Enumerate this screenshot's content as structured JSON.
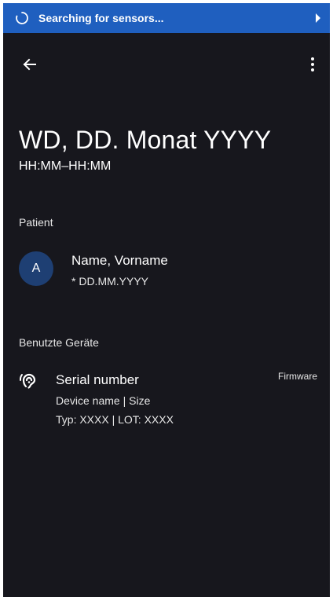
{
  "status_bar": {
    "text": "Searching for sensors...",
    "background": "#1f5fbf"
  },
  "toolbar": {
    "back_icon": "arrow-left-icon",
    "menu_icon": "more-vertical-icon"
  },
  "header": {
    "title": "WD, DD. Monat YYYY",
    "subtitle": "HH:MM–HH:MM"
  },
  "patient_section": {
    "label": "Patient",
    "avatar_initial": "A",
    "avatar_color": "#1e3f73",
    "name": "Name, Vorname",
    "dob": "* DD.MM.YYYY"
  },
  "devices_section": {
    "label": "Benutzte Geräte",
    "device": {
      "icon": "hearing-aid-icon",
      "serial": "Serial number",
      "firmware": "Firmware",
      "name_size": "Device name | Size",
      "type_lot": "Typ: XXXX | LOT: XXXX"
    }
  },
  "colors": {
    "background": "#17171d",
    "text": "#ffffff",
    "accent": "#1f5fbf"
  }
}
